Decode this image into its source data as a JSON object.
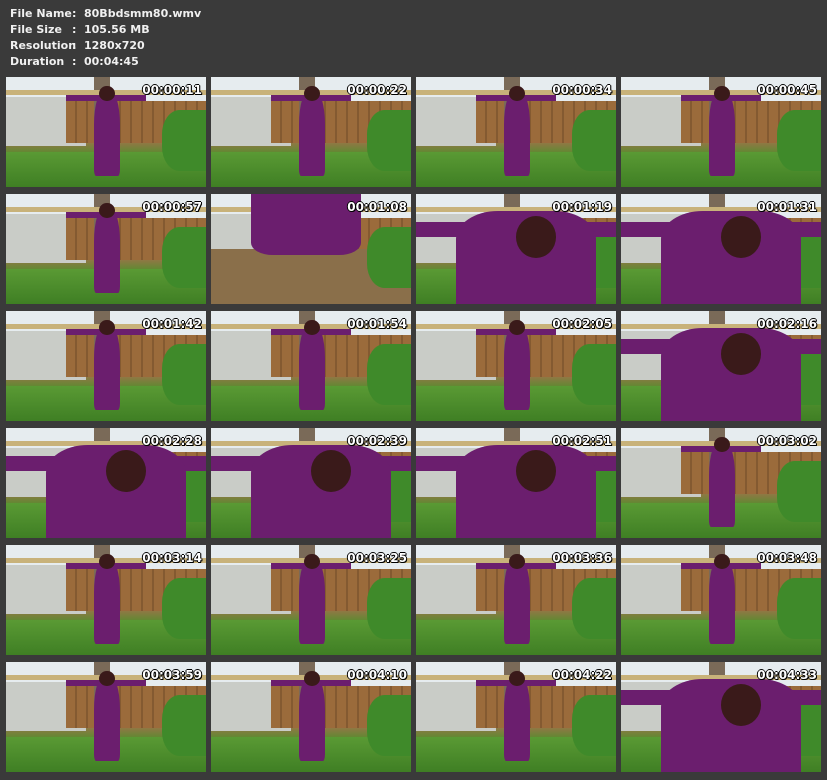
{
  "meta": {
    "file_name_key": "File Name",
    "file_name_val": "80Bbdsmm80.wmv",
    "file_size_key": "File Size",
    "file_size_val": "105.56 MB",
    "resolution_key": "Resolution",
    "resolution_val": "1280x720",
    "duration_key": "Duration",
    "duration_val": "00:04:45",
    "colon": ":"
  },
  "thumbs": [
    {
      "ts": "00:00:11",
      "view": "full"
    },
    {
      "ts": "00:00:22",
      "view": "full"
    },
    {
      "ts": "00:00:34",
      "view": "full"
    },
    {
      "ts": "00:00:45",
      "view": "full"
    },
    {
      "ts": "00:00:57",
      "view": "full"
    },
    {
      "ts": "00:01:08",
      "view": "feet"
    },
    {
      "ts": "00:01:19",
      "view": "close"
    },
    {
      "ts": "00:01:31",
      "view": "close"
    },
    {
      "ts": "00:01:42",
      "view": "full"
    },
    {
      "ts": "00:01:54",
      "view": "full"
    },
    {
      "ts": "00:02:05",
      "view": "full"
    },
    {
      "ts": "00:02:16",
      "view": "close"
    },
    {
      "ts": "00:02:28",
      "view": "close"
    },
    {
      "ts": "00:02:39",
      "view": "close"
    },
    {
      "ts": "00:02:51",
      "view": "close"
    },
    {
      "ts": "00:03:02",
      "view": "full"
    },
    {
      "ts": "00:03:14",
      "view": "full"
    },
    {
      "ts": "00:03:25",
      "view": "full"
    },
    {
      "ts": "00:03:36",
      "view": "full"
    },
    {
      "ts": "00:03:48",
      "view": "full"
    },
    {
      "ts": "00:03:59",
      "view": "full"
    },
    {
      "ts": "00:04:10",
      "view": "full"
    },
    {
      "ts": "00:04:22",
      "view": "full"
    },
    {
      "ts": "00:04:33",
      "view": "close"
    }
  ]
}
